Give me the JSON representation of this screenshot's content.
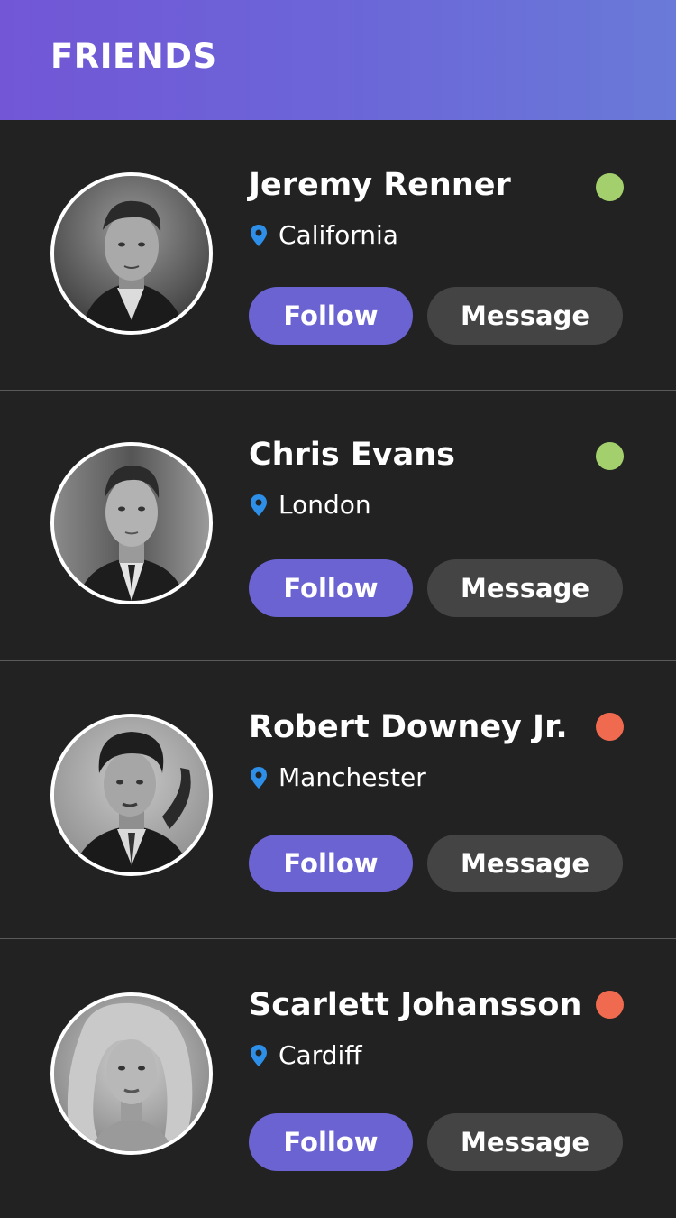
{
  "header": {
    "title": "FRIENDS",
    "gradient_start": "#7256d6",
    "gradient_end": "#6a7ad8"
  },
  "colors": {
    "background": "#222222",
    "online": "#a3d06c",
    "offline": "#ef6a4f",
    "follow_button": "#6b63d2",
    "message_button": "#444444",
    "pin_icon": "#2d8fe8"
  },
  "friends": [
    {
      "name": "Jeremy Renner",
      "location": "California",
      "status": "online",
      "follow_label": "Follow",
      "message_label": "Message",
      "avatar": "avatar-photo-jeremy-renner"
    },
    {
      "name": "Chris Evans",
      "location": "London",
      "status": "online",
      "follow_label": "Follow",
      "message_label": "Message",
      "avatar": "avatar-photo-chris-evans"
    },
    {
      "name": "Robert Downey Jr.",
      "location": "Manchester",
      "status": "offline",
      "follow_label": "Follow",
      "message_label": "Message",
      "avatar": "avatar-photo-robert-downey-jr"
    },
    {
      "name": "Scarlett Johansson",
      "location": "Cardiff",
      "status": "offline",
      "follow_label": "Follow",
      "message_label": "Message",
      "avatar": "avatar-photo-scarlett-johansson"
    }
  ]
}
